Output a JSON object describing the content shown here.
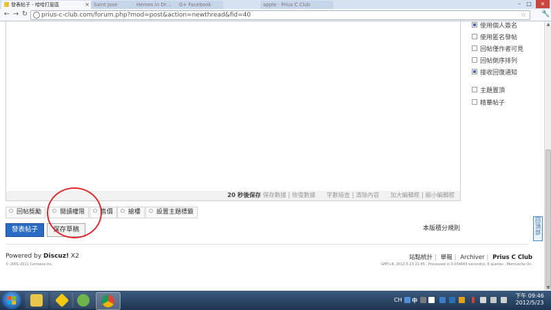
{
  "browser": {
    "active_tab_title": "發表帖子 - 哈哈打屁區",
    "inactive_tabs": [
      "Saint Jose",
      "Heroes in Dr…",
      "G+ Facebook",
      "apple · Prius C Club"
    ],
    "url": "prius-c-club.com/forum.php?mod=post&action=newthread&fid=40"
  },
  "options": [
    {
      "label": "使用個人簽名",
      "checked": true
    },
    {
      "label": "使用匿名發帖",
      "checked": false
    },
    {
      "label": "回帖僅作者可見",
      "checked": false
    },
    {
      "label": "回帖倒序排列",
      "checked": false
    },
    {
      "label": "接收回復通知",
      "checked": true
    },
    {
      "label": "主題置頂",
      "checked": false
    },
    {
      "label": "精華帖子",
      "checked": false
    }
  ],
  "editor_status": {
    "autosave": "20 秒後保存",
    "save_data": "保存數據",
    "restore_data": "恢復數據",
    "word_check": "字數檢查",
    "clear": "清除內容",
    "enlarge": "加大編輯框",
    "shrink": "縮小編輯框"
  },
  "attachment_buttons": [
    "回帖獎勵",
    "閱讀權限",
    "售價",
    "搶樓",
    "設置主題標籤"
  ],
  "actions": {
    "submit": "發表帖子",
    "save_draft": "保存草稿",
    "rules": "本版積分規則"
  },
  "footer": {
    "powered_by": "Powered by",
    "discuz": "Discuz!",
    "version": "X2",
    "copyright": "© 2001-2011 Comsenz Inc.",
    "links": [
      "站點統計",
      "舉報",
      "Archiver"
    ],
    "site_name": "Prius C Club",
    "gmt_info": "GMT+8, 2012-5-23 21:45 , Processed in 0.034663 second(s), 6 queries , Memcache On."
  },
  "back_to_top": "回頂部",
  "taskbar": {
    "lang": "CH",
    "ime": "中",
    "time": "下午 09:46",
    "date": "2012/5/23"
  },
  "colors": {
    "primary_button": "#2a6cc4",
    "annotation_circle": "#e0262b",
    "taskbar": "#1d3450"
  }
}
